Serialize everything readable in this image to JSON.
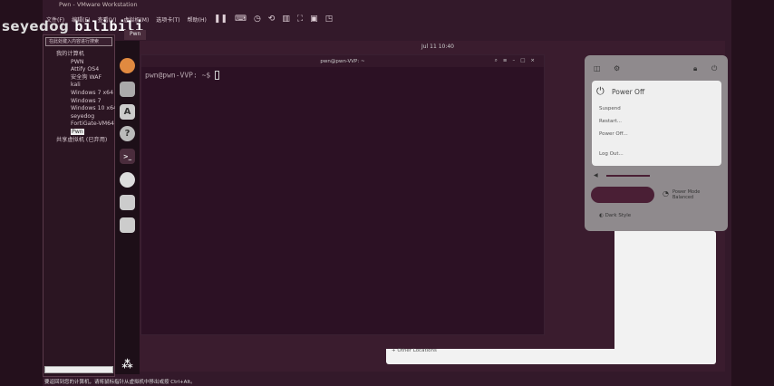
{
  "window": {
    "title": "Pwn - VMware Workstation"
  },
  "menu": [
    "文件(F)",
    "编辑(E)",
    "查看(V)",
    "虚拟机(M)",
    "选项卡(T)",
    "帮助(H)"
  ],
  "watermark": {
    "user": "seyedog",
    "site": "bilibili"
  },
  "library": {
    "search_placeholder": "在此处键入内容进行搜索",
    "root": "我的计算机",
    "vms": [
      "PWN",
      "Attify OS4",
      "安全狗 WAF",
      "kali",
      "Windows 7 x64",
      "Windows 7",
      "Windows 10 x64",
      "seyedog",
      "FortiGate-VM64",
      "Pwn"
    ],
    "shared": "共享虚拟机 (已弃用)"
  },
  "tab": {
    "label": "Pwn"
  },
  "guest": {
    "clock": "Jul 11 10:40"
  },
  "terminal": {
    "title": "pwn@pwn-VVP: ~",
    "prompt": "pwn@pwn-VVP: ~$"
  },
  "files": {
    "other_locations": "+ Other Locations"
  },
  "power_menu": {
    "title": "Power Off",
    "items": [
      "Suspend",
      "Restart...",
      "Power Off...",
      "Log Out..."
    ],
    "power_mode": "Power Mode",
    "power_mode_value": "Balanced",
    "dark_style": "Dark Style"
  },
  "status": {
    "text": "要返回到您的计算机，请将鼠标指针从虚拟机中移出或按 Ctrl+Alt。"
  }
}
